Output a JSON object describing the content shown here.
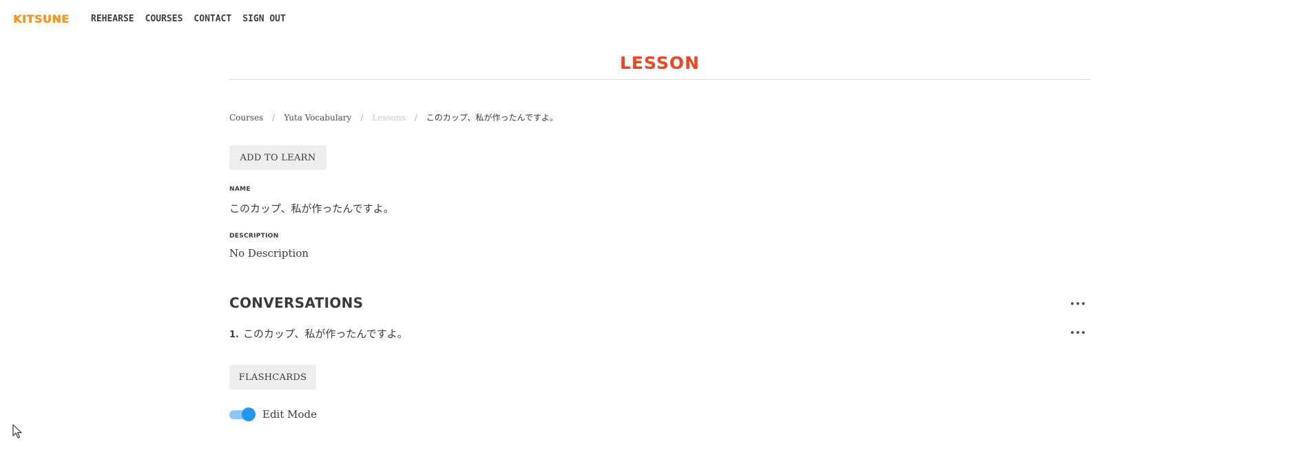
{
  "brand": {
    "logo_text": "KITSUNE",
    "accent": "#f7941d"
  },
  "nav": {
    "items": [
      {
        "label": "REHEARSE"
      },
      {
        "label": "COURSES"
      },
      {
        "label": "CONTACT"
      },
      {
        "label": "SIGN OUT"
      }
    ]
  },
  "page": {
    "title": "LESSON",
    "title_color": "#f0451e"
  },
  "breadcrumb": {
    "items": [
      {
        "label": "Courses"
      },
      {
        "label": "Yuta Vocabulary"
      },
      {
        "label": "Lessons"
      },
      {
        "label": "このカップ、私が作ったんですよ。"
      }
    ],
    "separator": "/"
  },
  "actions": {
    "add_to_learn_label": "ADD TO LEARN",
    "flashcards_label": "FLASHCARDS"
  },
  "fields": {
    "name_label": "NAME",
    "name_value": "このカップ、私が作ったんですよ。",
    "description_label": "DESCRIPTION",
    "description_value": "No Description"
  },
  "conversations": {
    "title": "CONVERSATIONS",
    "items": [
      {
        "number": "1.",
        "text": "このカップ、私が作ったんですよ。"
      }
    ]
  },
  "edit_mode": {
    "label": "Edit Mode",
    "enabled": true,
    "color": "#2196f3"
  },
  "icons": {
    "more": "more-horizontal-icon",
    "cursor": "mouse-pointer-icon"
  }
}
